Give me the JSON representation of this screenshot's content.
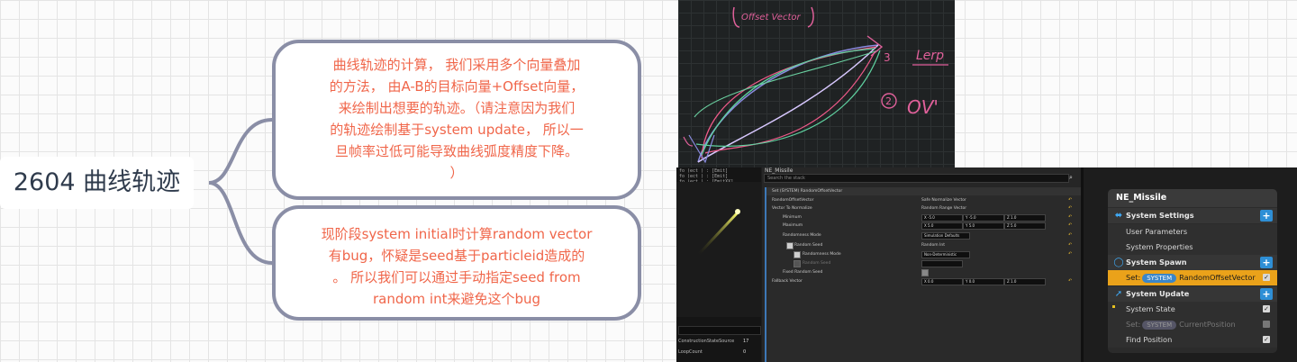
{
  "mindmap": {
    "topic": "2604 曲线轨迹",
    "node1_lines": [
      "曲线轨迹的计算， 我们采用多个向量叠加",
      "的方法， 由A-B的目标向量+Offset向量，",
      "来绘制出想要的轨迹。（请注意因为我们",
      "的轨迹绘制基于system update， 所以一",
      "旦帧率过低可能导致曲线弧度精度下降。",
      "）"
    ],
    "node2_lines": [
      "现阶段system initial时计算random vector",
      "有bug，怀疑是seed基于particleid造成的",
      "。 所以我们可以通过手动指定seed from",
      "random int来避免这个bug"
    ]
  },
  "sketch": {
    "label_offset": "Offset Vector",
    "label_3": "3",
    "label_lerp": "Lerp",
    "label_2": "2",
    "label_ov": "OV'"
  },
  "editor": {
    "outliner_lines": [
      "fo (ect ) : [Emit]",
      "fo (ect ) : [Emit]",
      "fo (ect ) : [EmitXX]",
      "fo (ect ) : [EmitXX]"
    ],
    "panel_title": "NE_Missile",
    "search_placeholder": "Search the stack",
    "module_title": "Set (SYSTEM) RandomOffsetVector",
    "rows": [
      {
        "label": "RandomOffsetVector",
        "value": "Safe Normalize Vector"
      },
      {
        "label": "Vector To Normalize",
        "value": "Random Range Vector"
      },
      {
        "label": "Minimum",
        "x": "X -5.0",
        "y": "Y -5.0",
        "z": "Z 1.0"
      },
      {
        "label": "Maximum",
        "x": "X 5.0",
        "y": "Y 5.0",
        "z": "Z 5.0"
      },
      {
        "label": "Randomness Mode",
        "value": "Simulation Defaults"
      },
      {
        "label": "Random Seed",
        "value": "Random Int"
      },
      {
        "label": "Randomness Mode",
        "value": "Non-Deterministic"
      },
      {
        "label": "Random Seed",
        "value": ""
      },
      {
        "label": "Fixed Random Seed",
        "value": ""
      },
      {
        "label": "Fallback Vector",
        "x": "X 0.0",
        "y": "Y 0.0",
        "z": "Z 1.0"
      }
    ],
    "viewport_rows": [
      {
        "label": "ConstructionStateSource",
        "value": "17"
      },
      {
        "label": "LoopCount",
        "value": "0"
      }
    ]
  },
  "stack": {
    "title": "NE_Missile",
    "system_settings": "System Settings",
    "user_parameters": "User Parameters",
    "system_properties": "System Properties",
    "system_spawn": "System Spawn",
    "set_prefix": "Set:",
    "pill_system": "SYSTEM",
    "random_offset": "RandomOffsetVector",
    "system_update": "System Update",
    "system_state": "System State",
    "current_position": "CurrentPosition",
    "find_position": "Find Position",
    "plus": "+",
    "check": "✓"
  },
  "colors": {
    "accent_blue": "#3fa9f5",
    "selection": "#eaa21a",
    "bubble_text": "#f0664a",
    "bubble_border": "#8a8ea6"
  }
}
